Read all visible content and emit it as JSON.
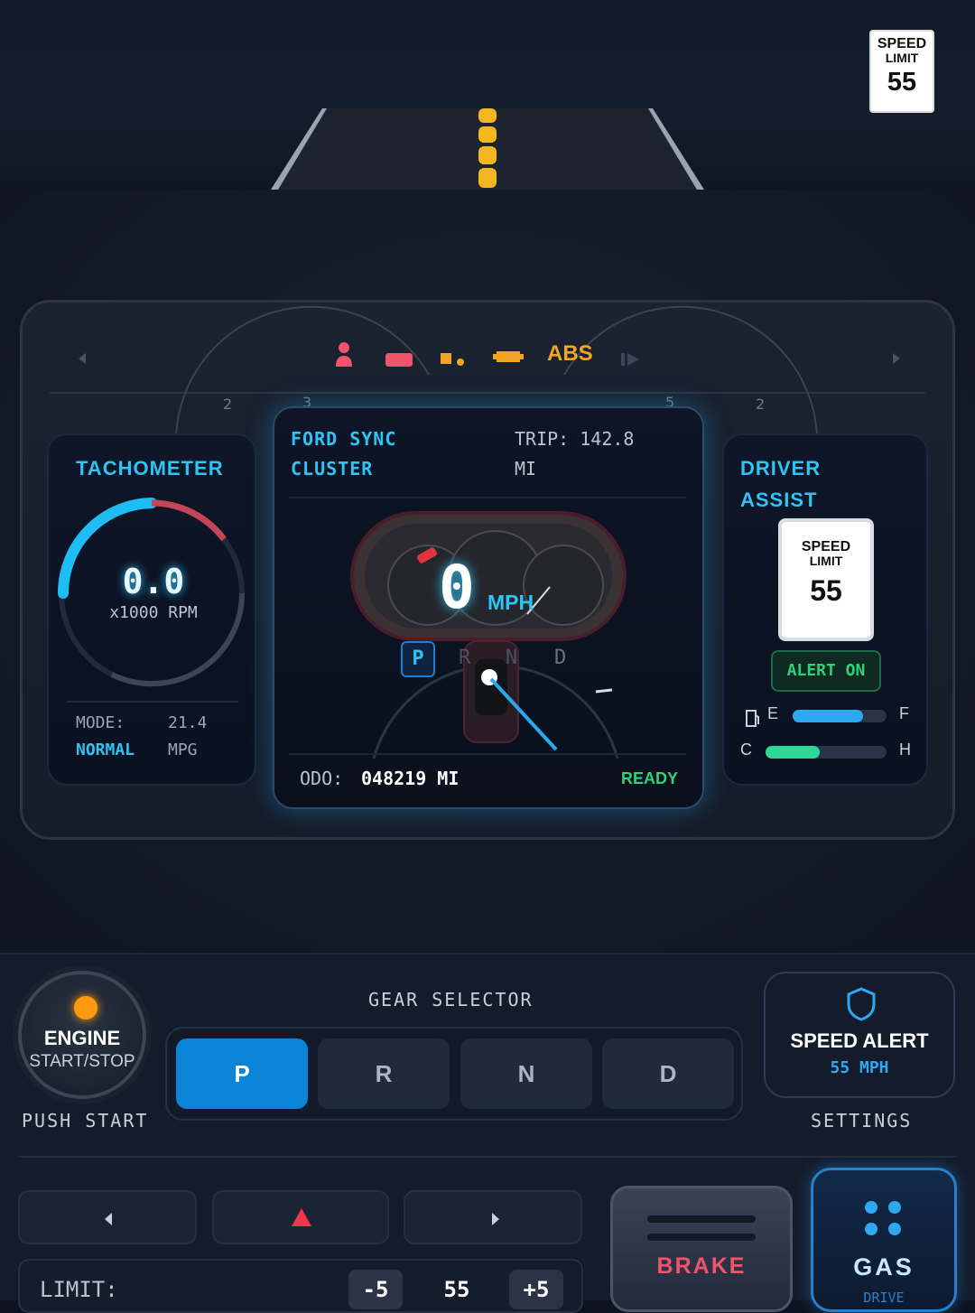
{
  "top_sign": {
    "line1": "SPEED",
    "line2": "LIMIT",
    "value": "55"
  },
  "warnings": {
    "abs": "ABS"
  },
  "tachometer": {
    "title": "TACHOMETER",
    "value": "0.0",
    "unit": "x1000 RPM",
    "mode_label": "MODE:",
    "mode_value": "NORMAL",
    "mpg_value": "21.4",
    "mpg_unit": "MPG"
  },
  "center": {
    "title_line1": "FORD SYNC",
    "title_line2": "CLUSTER",
    "trip_label": "TRIP: 142.8",
    "trip_unit": "MI",
    "speed": "0",
    "speed_unit": "MPH",
    "gears": [
      "P",
      "R",
      "N",
      "D"
    ],
    "active_gear": "P",
    "odo_label": "ODO:",
    "odo_value": "048219 MI",
    "status": "READY"
  },
  "driver_assist": {
    "title_line1": "DRIVER",
    "title_line2": "ASSIST",
    "sign_line1": "SPEED",
    "sign_line2": "LIMIT",
    "sign_value": "55",
    "alert": "ALERT ON",
    "fuel_e": "E",
    "fuel_f": "F",
    "fuel_level": 0.75,
    "temp_c": "C",
    "temp_h": "H",
    "temp_level": 0.45
  },
  "engine": {
    "line1": "ENGINE",
    "line2": "START/STOP",
    "caption": "PUSH START"
  },
  "gear_selector": {
    "title": "GEAR SELECTOR",
    "options": [
      "P",
      "R",
      "N",
      "D"
    ],
    "active": "P"
  },
  "speed_alert": {
    "title": "SPEED ALERT",
    "value": "55 MPH",
    "caption": "SETTINGS"
  },
  "limit": {
    "label": "LIMIT:",
    "minus": "-5",
    "value": "55",
    "plus": "+5"
  },
  "pedals": {
    "brake": "BRAKE",
    "gas": "GAS",
    "gas_sub": "DRIVE"
  },
  "colors": {
    "accent": "#2ec4f5",
    "active_blue": "#0a84d6",
    "ready": "#2ed27a",
    "brake": "#f0536c",
    "warning_amber": "#f2a524"
  }
}
